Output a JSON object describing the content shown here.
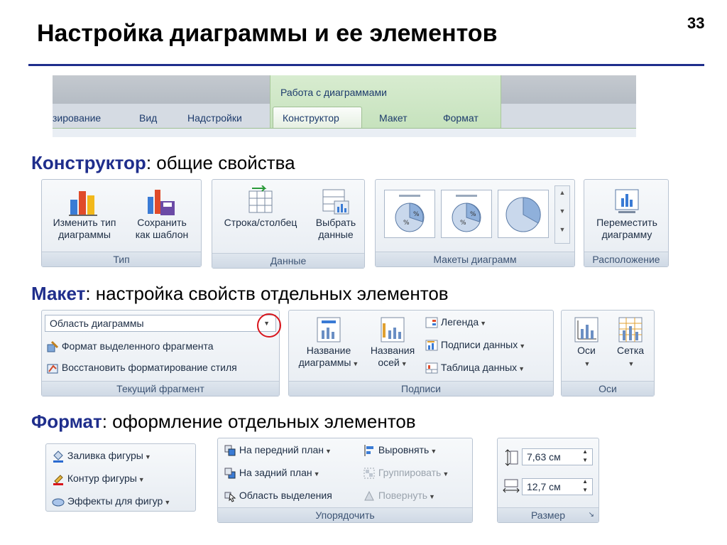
{
  "slide": {
    "title": "Настройка диаграммы и ее элементов",
    "page_number": "33"
  },
  "ribbon_tabs": {
    "context_group": "Работа с диаграммами",
    "tabs": [
      "зирование",
      "Вид",
      "Надстройки",
      "Конструктор",
      "Макет",
      "Формат"
    ],
    "active_tab": "Конструктор"
  },
  "sections": {
    "constructor": {
      "key": "Конструктор",
      "rest": ": общие свойства"
    },
    "layout": {
      "key": "Макет",
      "rest": ": настройка свойств отдельных элементов"
    },
    "format": {
      "key": "Формат",
      "rest": ": оформление отдельных элементов"
    }
  },
  "constructor_ribbon": {
    "type_group": {
      "label": "Тип",
      "change_type": [
        "Изменить тип",
        "диаграммы"
      ],
      "save_template": [
        "Сохранить",
        "как шаблон"
      ]
    },
    "data_group": {
      "label": "Данные",
      "row_column": "Строка/столбец",
      "select_data": [
        "Выбрать",
        "данные"
      ]
    },
    "layouts_group": {
      "label": "Макеты диаграмм"
    },
    "location_group": {
      "label": "Расположение",
      "move_chart": [
        "Переместить",
        "диаграмму"
      ]
    }
  },
  "layout_ribbon": {
    "current_fragment": {
      "label": "Текущий фрагмент",
      "dropdown_value": "Область диаграммы",
      "format_selection": "Формат выделенного фрагмента",
      "reset_style": "Восстановить форматирование стиля"
    },
    "labels_group": {
      "label": "Подписи",
      "chart_title": [
        "Название",
        "диаграммы"
      ],
      "axis_titles": [
        "Названия",
        "осей"
      ],
      "legend": "Легенда",
      "data_labels": "Подписи данных",
      "data_table": "Таблица данных"
    },
    "axes_group": {
      "label": "Оси",
      "axes": "Оси",
      "gridlines": "Сетка"
    }
  },
  "format_ribbon": {
    "shape_styles": {
      "fill": "Заливка фигуры",
      "outline": "Контур фигуры",
      "effects": "Эффекты для фигур"
    },
    "arrange": {
      "label": "Упорядочить",
      "bring_front": "На передний план",
      "send_back": "На задний план",
      "selection_pane": "Область выделения",
      "align": "Выровнять",
      "group": "Группировать",
      "rotate": "Повернуть"
    },
    "size": {
      "label": "Размер",
      "height": "7,63 см",
      "width": "12,7 см"
    }
  },
  "colors": {
    "title_rule": "#1f2e8c",
    "section_key": "#1f2e8c",
    "highlight_circle": "#d8141b",
    "context_group": "#c6e2bd"
  }
}
